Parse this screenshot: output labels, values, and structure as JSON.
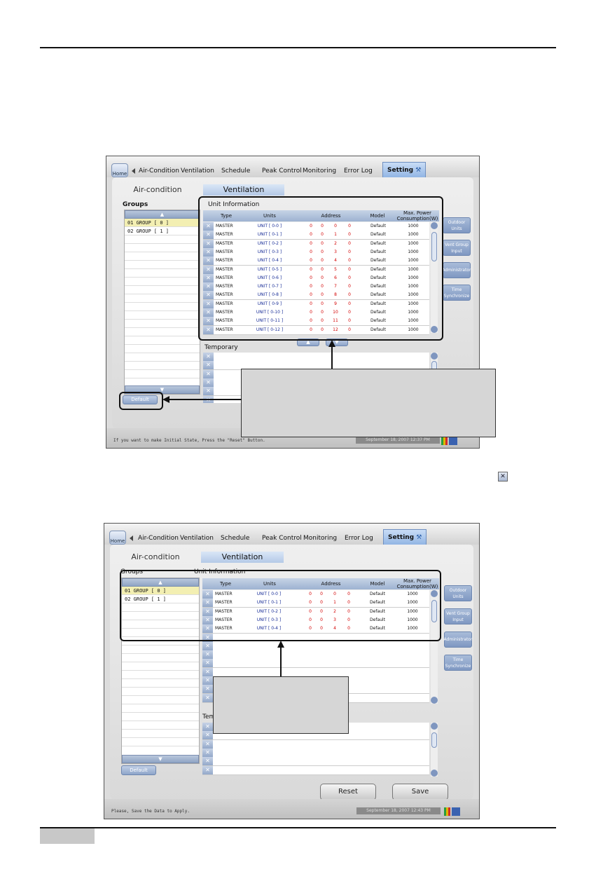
{
  "inline_icon": "x-delete-icon",
  "screen1": {
    "home_label": "Home",
    "tabs": [
      "Air-Condition",
      "Ventilation",
      "Schedule",
      "Peak Control",
      "Monitoring",
      "Error Log",
      "Setting"
    ],
    "subtabs": [
      "Air-condition",
      "Ventilation"
    ],
    "groups_label": "Groups",
    "groups": [
      "01   GROUP [ 0 ]",
      "02   GROUP [ 1 ]"
    ],
    "unit_info_label": "Unit Information",
    "columns": [
      "Type",
      "Units",
      "Address",
      "Model",
      "Max. Power",
      "Consumption(W)"
    ],
    "rows": [
      [
        "MASTER",
        "UNIT [ 0-0 ]",
        "0",
        "0",
        "0",
        "0",
        "Default",
        "1000"
      ],
      [
        "MASTER",
        "UNIT [ 0-1 ]",
        "0",
        "0",
        "1",
        "0",
        "Default",
        "1000"
      ],
      [
        "MASTER",
        "UNIT [ 0-2 ]",
        "0",
        "0",
        "2",
        "0",
        "Default",
        "1000"
      ],
      [
        "MASTER",
        "UNIT [ 0-3 ]",
        "0",
        "0",
        "3",
        "0",
        "Default",
        "1000"
      ],
      [
        "MASTER",
        "UNIT [ 0-4 ]",
        "0",
        "0",
        "4",
        "0",
        "Default",
        "1000"
      ],
      [
        "MASTER",
        "UNIT [ 0-5 ]",
        "0",
        "0",
        "5",
        "0",
        "Default",
        "1000"
      ],
      [
        "MASTER",
        "UNIT [ 0-6 ]",
        "0",
        "0",
        "6",
        "0",
        "Default",
        "1000"
      ],
      [
        "MASTER",
        "UNIT [ 0-7 ]",
        "0",
        "0",
        "7",
        "0",
        "Default",
        "1000"
      ],
      [
        "MASTER",
        "UNIT [ 0-8 ]",
        "0",
        "0",
        "8",
        "0",
        "Default",
        "1000"
      ],
      [
        "MASTER",
        "UNIT [ 0-9 ]",
        "0",
        "0",
        "9",
        "0",
        "Default",
        "1000"
      ],
      [
        "MASTER",
        "UNIT [ 0-10 ]",
        "0",
        "0",
        "10",
        "0",
        "Default",
        "1000"
      ],
      [
        "MASTER",
        "UNIT [ 0-11 ]",
        "0",
        "0",
        "11",
        "0",
        "Default",
        "1000"
      ],
      [
        "MASTER",
        "UNIT [ 0-12 ]",
        "0",
        "0",
        "12",
        "0",
        "Default",
        "1000"
      ]
    ],
    "temporary_label": "Temporary",
    "side_buttons": [
      "Outdoor Units",
      "Vent Group Input",
      "Administrator",
      "Time Synchronize"
    ],
    "default_button": "Default",
    "status_text": "If you want to make Initial State, Press the \"Reset\" Button.",
    "date": "September 18, 2007 12:37 PM"
  },
  "screen2": {
    "home_label": "Home",
    "tabs": [
      "Air-Condition",
      "Ventilation",
      "Schedule",
      "Peak Control",
      "Monitoring",
      "Error Log",
      "Setting"
    ],
    "subtabs": [
      "Air-condition",
      "Ventilation"
    ],
    "groups_label": "Groups",
    "groups": [
      "01   GROUP [ 0 ]",
      "02   GROUP [ 1 ]"
    ],
    "unit_info_label": "Unit Information",
    "columns": [
      "Type",
      "Units",
      "Address",
      "Model",
      "Max. Power",
      "Consumption(W)"
    ],
    "rows": [
      [
        "MASTER",
        "UNIT [ 0-0 ]",
        "0",
        "0",
        "0",
        "0",
        "Default",
        "1000"
      ],
      [
        "MASTER",
        "UNIT [ 0-1 ]",
        "0",
        "0",
        "1",
        "0",
        "Default",
        "1000"
      ],
      [
        "MASTER",
        "UNIT [ 0-2 ]",
        "0",
        "0",
        "2",
        "0",
        "Default",
        "1000"
      ],
      [
        "MASTER",
        "UNIT [ 0-3 ]",
        "0",
        "0",
        "3",
        "0",
        "Default",
        "1000"
      ],
      [
        "MASTER",
        "UNIT [ 0-4 ]",
        "0",
        "0",
        "4",
        "0",
        "Default",
        "1000"
      ]
    ],
    "temporary_label": "Tem",
    "side_buttons": [
      "Outdoor Units",
      "Vent Group Input",
      "Administrator",
      "Time Synchronize"
    ],
    "default_button": "Default",
    "reset_button": "Reset",
    "save_button": "Save",
    "status_text": "Please, Save the Data to Apply.",
    "date": "September 18, 2007 12:43 PM"
  }
}
